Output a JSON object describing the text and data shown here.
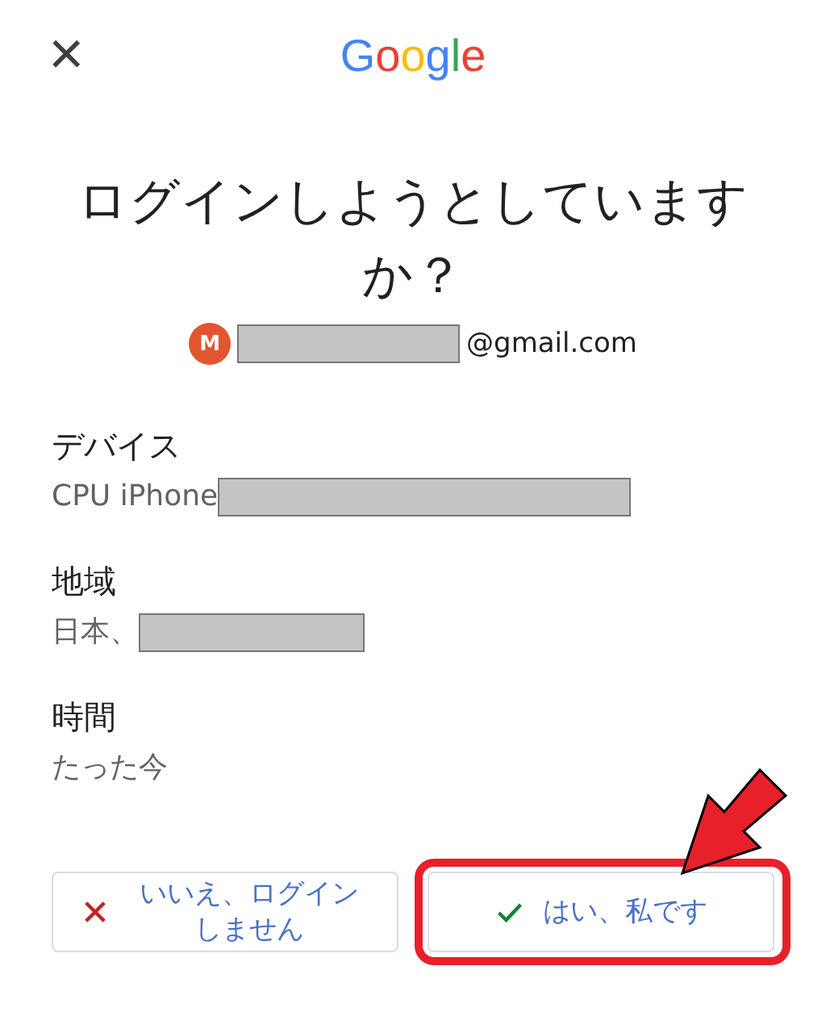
{
  "header": {
    "close": "×",
    "logo": "Google"
  },
  "title": "ログインしようとしていますか？",
  "account": {
    "avatar": "M",
    "email_suffix": "@gmail.com"
  },
  "details": [
    {
      "label": "デバイス",
      "value": "CPU iPhone"
    },
    {
      "label": "地域",
      "value": "日本、"
    },
    {
      "label": "時間",
      "value": "たった今"
    }
  ],
  "buttons": [
    {
      "kind": "deny",
      "label": "いいえ、ログインしません",
      "highlighted": false
    },
    {
      "kind": "confirm",
      "label": "はい、私です",
      "highlighted": true
    }
  ]
}
